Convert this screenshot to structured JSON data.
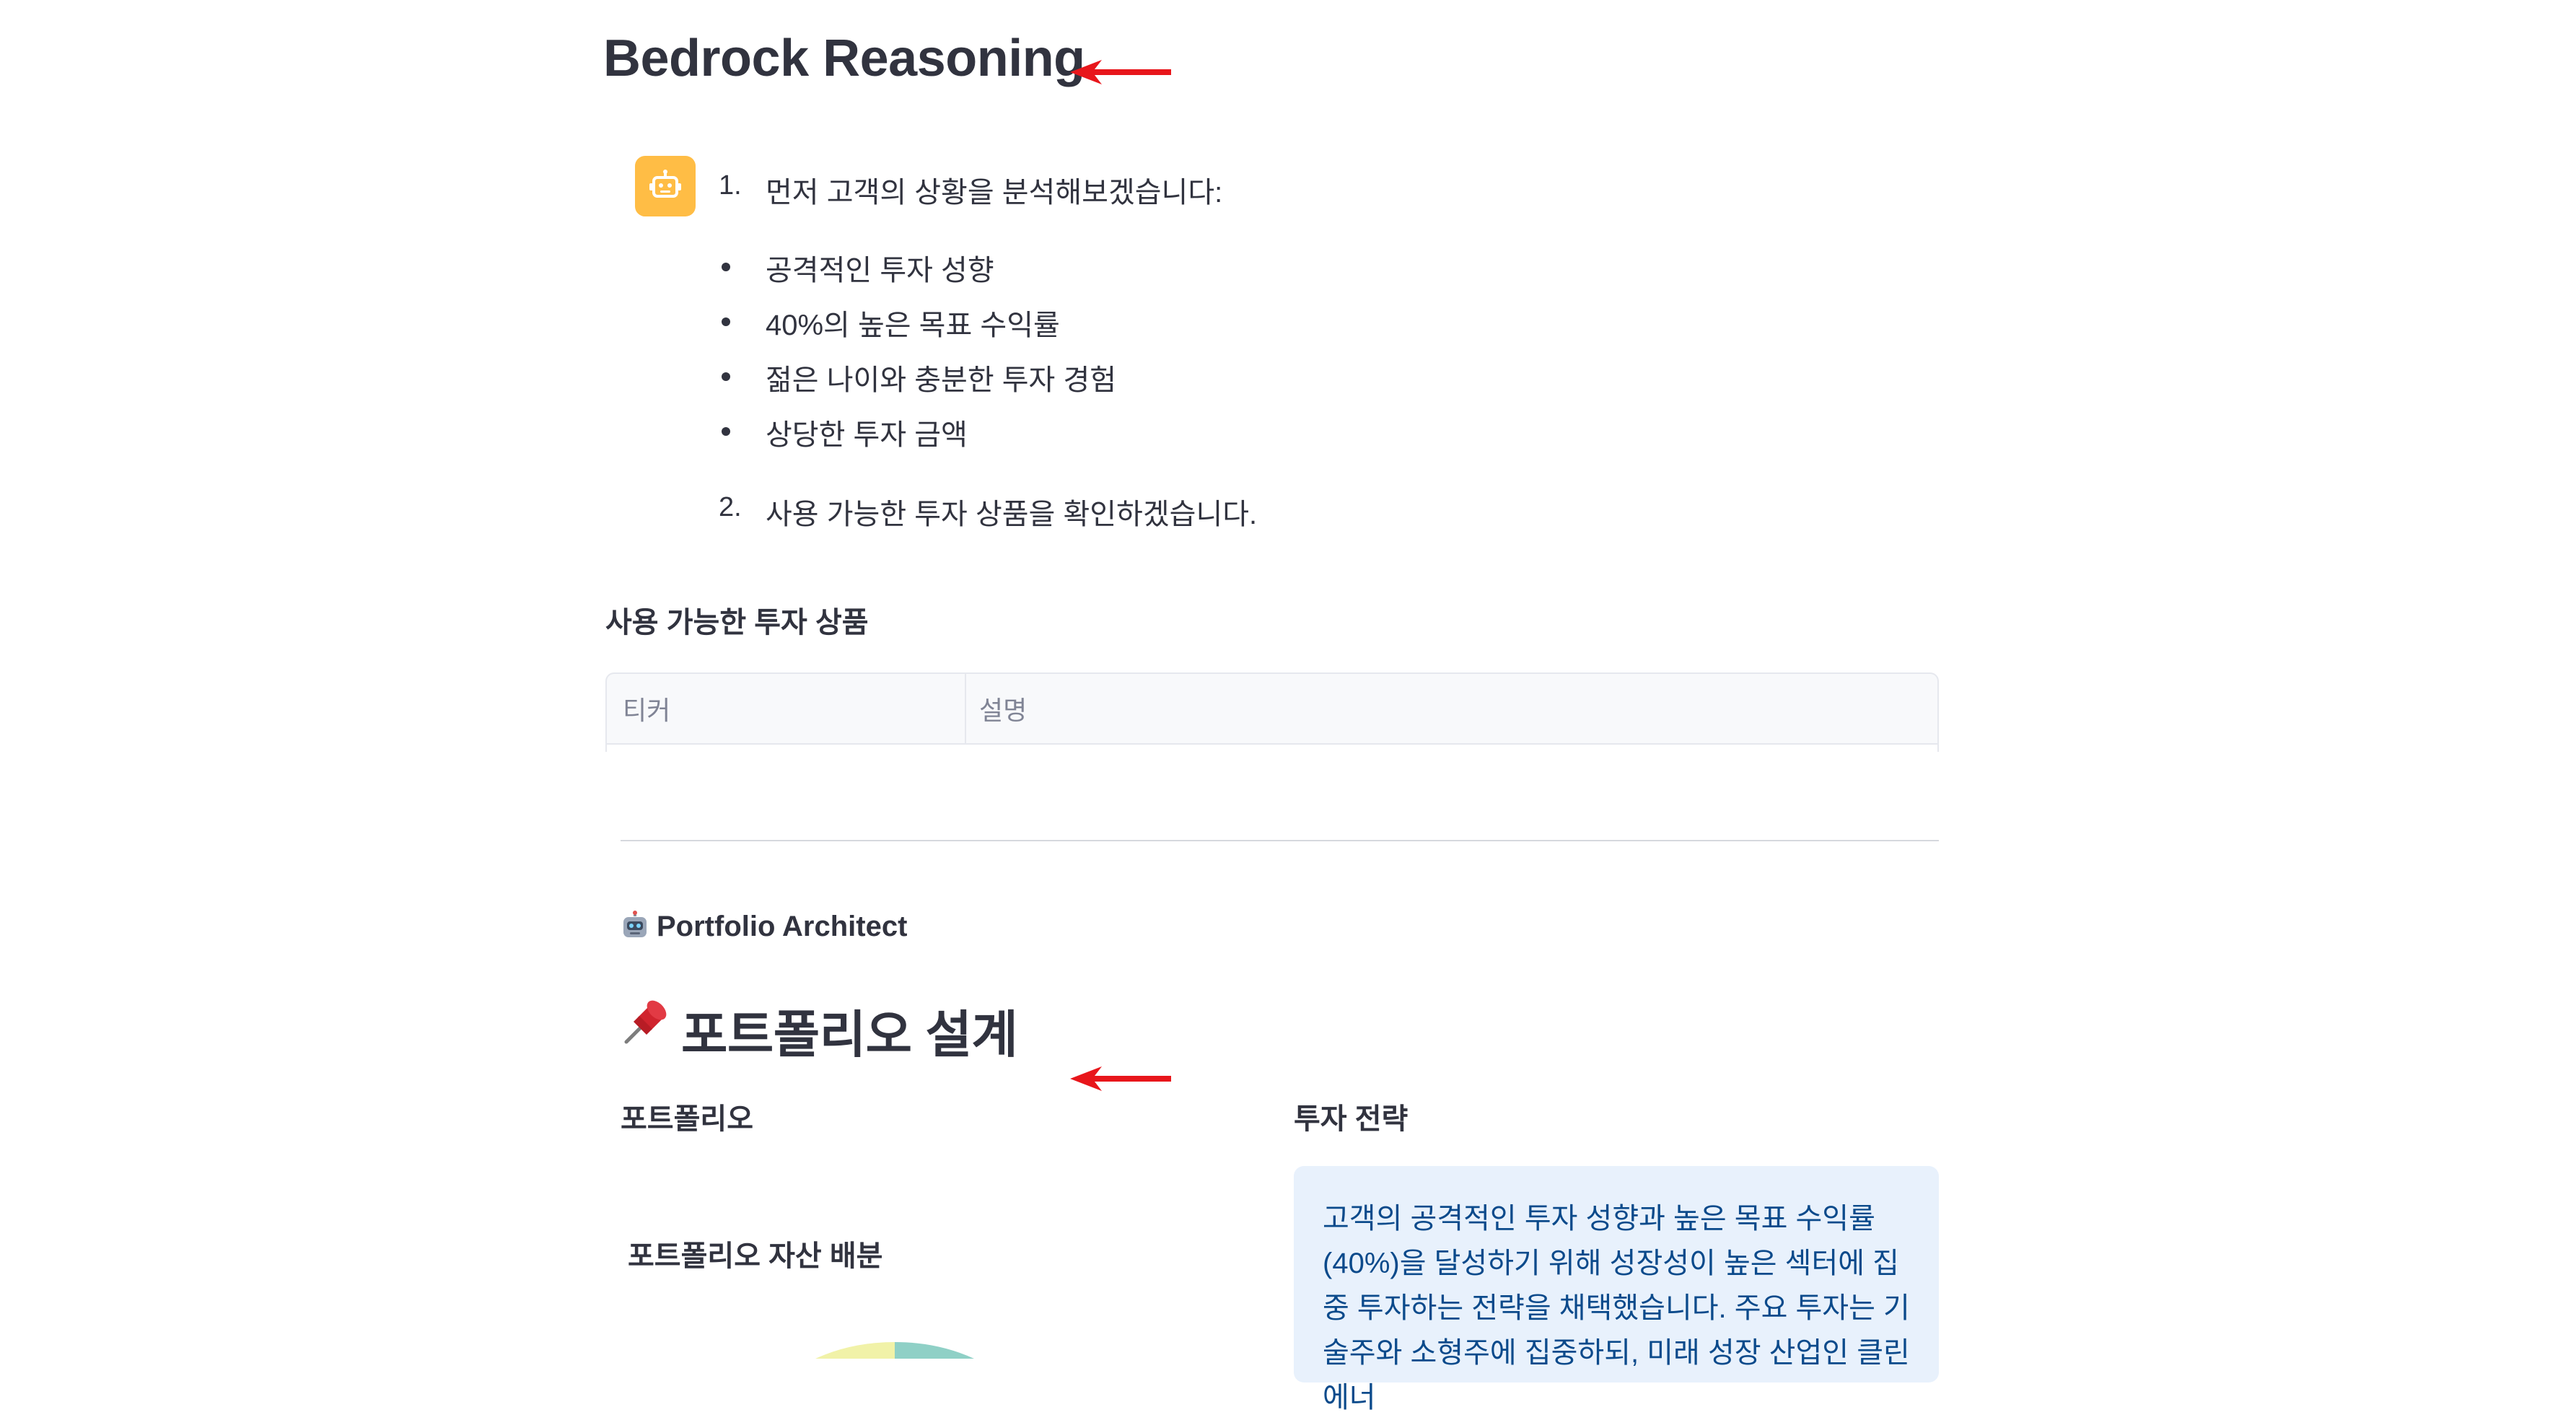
{
  "sections": {
    "reasoning_title": "Bedrock Reasoning",
    "message": {
      "avatar_icon": "robot-icon",
      "step1": {
        "num": "1.",
        "text": "먼저 고객의 상황을 분석해보겠습니다:"
      },
      "bullets": [
        "공격적인 투자 성향",
        "40%의 높은 목표 수익률",
        "젊은 나이와 충분한 투자 경험",
        "상당한 투자 금액"
      ],
      "step2": {
        "num": "2.",
        "text": "사용 가능한 투자 상품을 확인하겠습니다."
      }
    },
    "products": {
      "title": "사용 가능한 투자 상품",
      "columns": [
        "티커",
        "설명"
      ]
    },
    "architect": {
      "caption_icon": "robot-icon",
      "caption": "Portfolio Architect",
      "title_icon": "pushpin-icon",
      "title": "포트폴리오 설계",
      "left_header": "포트폴리오",
      "right_header": "투자 전략",
      "chart_title": "포트폴리오 자산 배분",
      "strategy_text": "고객의 공격적인 투자 성향과 높은 목표 수익률 (40%)을 달성하기 위해 성장성이 높은 섹터에 집중 투자하는 전략을 채택했습니다. 주요 투자는 기술주와 소형주에 집중하되, 미래 성장 산업인 클린에너"
    }
  },
  "colors": {
    "annotation_arrow": "#e8161b",
    "avatar_bg": "#ffbd45",
    "info_bg": "#e8f1fc",
    "info_text": "#0b4a8b"
  }
}
